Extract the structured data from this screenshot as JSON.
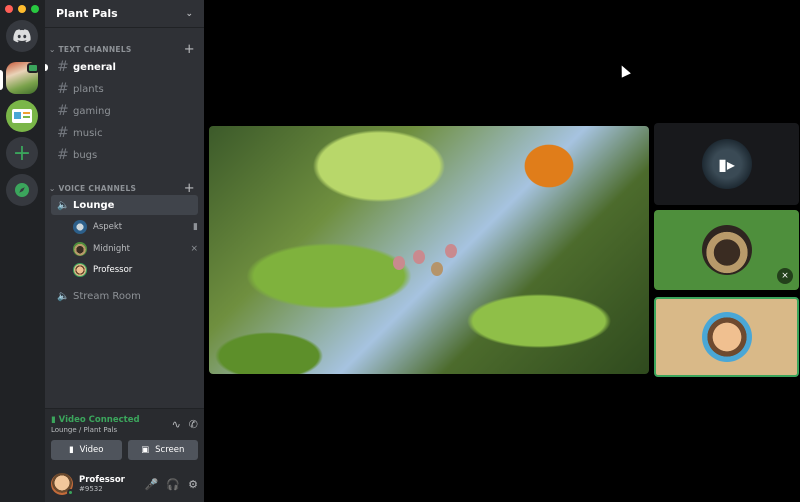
{
  "window": {
    "traffic_colors": [
      "#ff5f57",
      "#febc2e",
      "#28c840"
    ]
  },
  "servers": {
    "items": [
      {
        "name": "home",
        "icon": "discord-icon"
      },
      {
        "name": "plant-pals-server",
        "icon": "plant-server-icon"
      },
      {
        "name": "second-server",
        "icon": "server-icon"
      },
      {
        "name": "add-server",
        "icon": "plus-icon"
      },
      {
        "name": "explore",
        "icon": "compass-icon"
      }
    ]
  },
  "sidebar": {
    "server_name": "Plant Pals",
    "text_category": "TEXT CHANNELS",
    "voice_category": "VOICE CHANNELS",
    "text_channels": [
      "general",
      "plants",
      "gaming",
      "music",
      "bugs"
    ],
    "voice_channels": [
      "Lounge",
      "Stream Room"
    ],
    "voice_users": [
      {
        "name": "Aspekt",
        "status": "video-icon"
      },
      {
        "name": "Midnight",
        "status": "muted-icon"
      },
      {
        "name": "Professor",
        "status": ""
      }
    ]
  },
  "rtc": {
    "status": "Video Connected",
    "location": "Lounge / Plant Pals",
    "video_label": "Video",
    "screen_label": "Screen"
  },
  "user": {
    "name": "Professor",
    "tag": "#9532"
  },
  "colors": {
    "accent_green": "#3ba55c",
    "sidebar_bg": "#2f3136",
    "rail_bg": "#202225"
  }
}
